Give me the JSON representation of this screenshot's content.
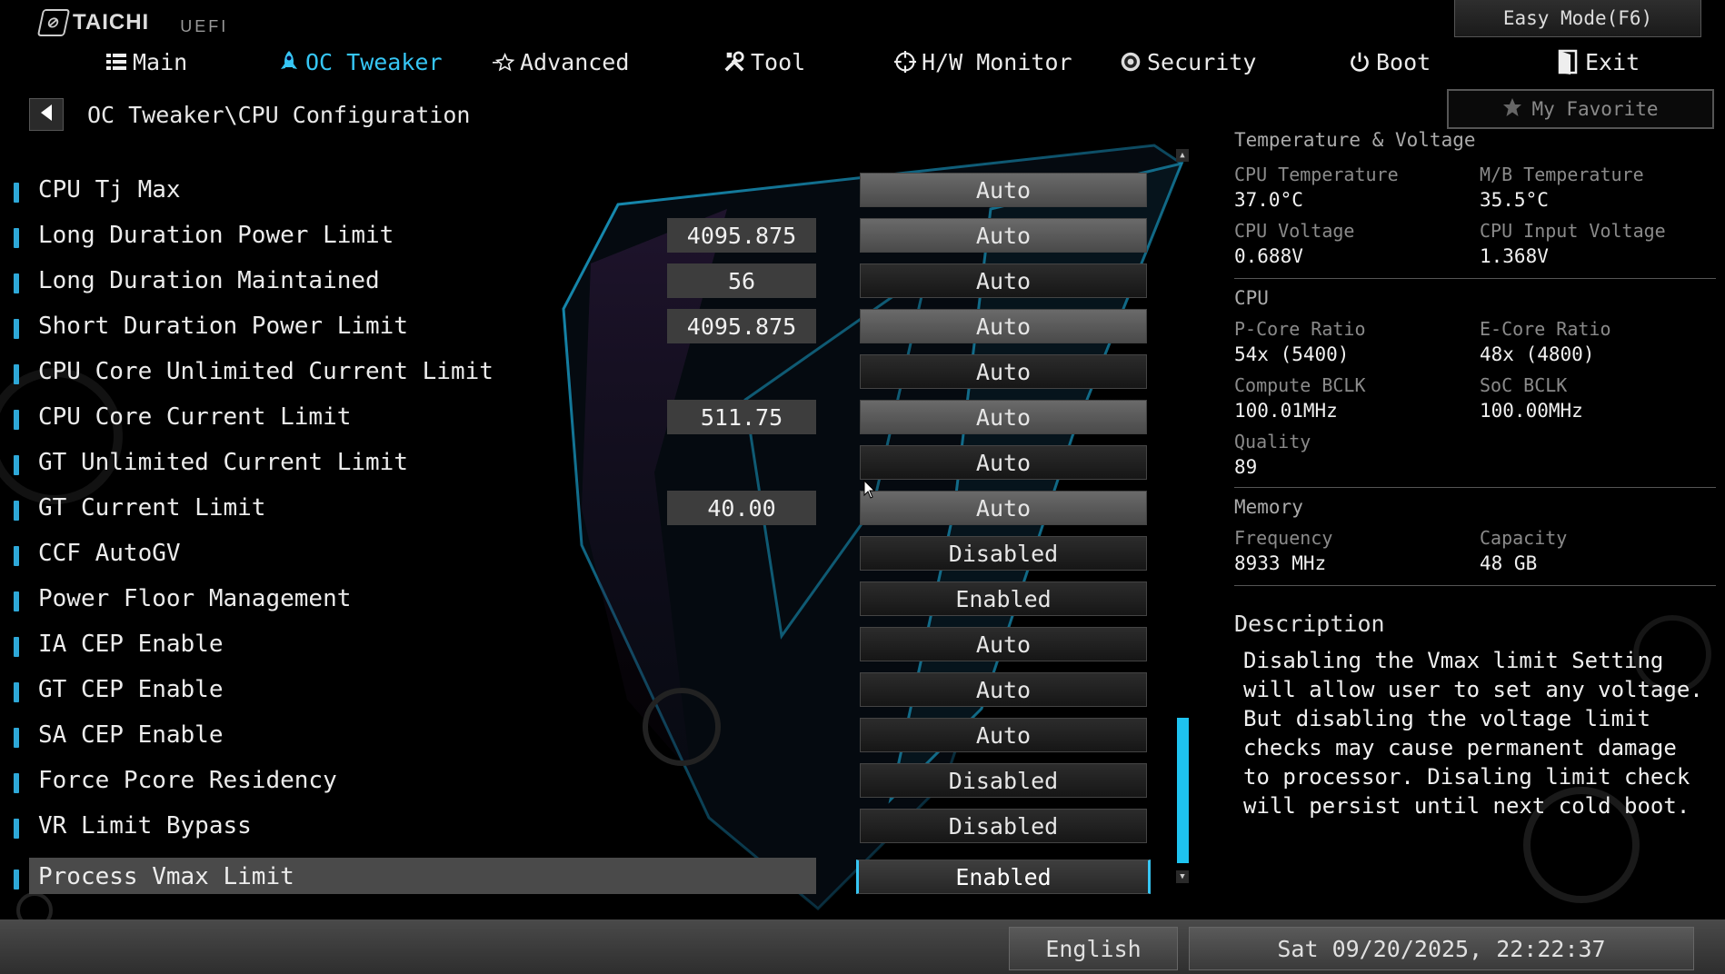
{
  "brand": {
    "name": "TAICHI",
    "sub": "UEFI"
  },
  "easy_mode_label": "Easy Mode(F6)",
  "nav": [
    {
      "label": "Main",
      "icon": "list-icon"
    },
    {
      "label": "OC Tweaker",
      "icon": "rocket-icon",
      "active": true
    },
    {
      "label": "Advanced",
      "icon": "star-outline-icon"
    },
    {
      "label": "Tool",
      "icon": "tools-icon"
    },
    {
      "label": "H/W Monitor",
      "icon": "crosshair-icon"
    },
    {
      "label": "Security",
      "icon": "shield-gear-icon"
    },
    {
      "label": "Boot",
      "icon": "power-icon"
    },
    {
      "label": "Exit",
      "icon": "exit-door-icon"
    }
  ],
  "breadcrumb": "OC Tweaker\\CPU Configuration",
  "favorite_label": "My Favorite",
  "settings": [
    {
      "label": "CPU Tj Max",
      "value": "",
      "option": "Auto",
      "style": "light"
    },
    {
      "label": "Long Duration Power Limit",
      "value": "4095.875",
      "option": "Auto",
      "style": "light"
    },
    {
      "label": "Long Duration Maintained",
      "value": "56",
      "option": "Auto",
      "style": "dark"
    },
    {
      "label": "Short Duration Power Limit",
      "value": "4095.875",
      "option": "Auto",
      "style": "light"
    },
    {
      "label": "CPU Core Unlimited Current Limit",
      "value": "",
      "option": "Auto",
      "style": "dark"
    },
    {
      "label": "CPU Core Current Limit",
      "value": "511.75",
      "option": "Auto",
      "style": "light"
    },
    {
      "label": "GT Unlimited Current Limit",
      "value": "",
      "option": "Auto",
      "style": "dark"
    },
    {
      "label": "GT Current Limit",
      "value": "40.00",
      "option": "Auto",
      "style": "light"
    },
    {
      "label": "CCF AutoGV",
      "value": "",
      "option": "Disabled",
      "style": "dark"
    },
    {
      "label": "Power Floor Management",
      "value": "",
      "option": "Enabled",
      "style": "dark"
    },
    {
      "label": "IA CEP Enable",
      "value": "",
      "option": "Auto",
      "style": "dark"
    },
    {
      "label": "GT CEP Enable",
      "value": "",
      "option": "Auto",
      "style": "dark"
    },
    {
      "label": "SA CEP Enable",
      "value": "",
      "option": "Auto",
      "style": "dark"
    },
    {
      "label": "Force Pcore Residency",
      "value": "",
      "option": "Disabled",
      "style": "dark"
    },
    {
      "label": "VR Limit Bypass",
      "value": "",
      "option": "Disabled",
      "style": "dark"
    },
    {
      "label": "Process Vmax Limit",
      "value": "",
      "option": "Enabled",
      "style": "focused",
      "selected": true
    }
  ],
  "hw_monitor": {
    "temp_title": "Temperature & Voltage",
    "cpu_temp_label": "CPU Temperature",
    "cpu_temp": "37.0°C",
    "mb_temp_label": "M/B Temperature",
    "mb_temp": "35.5°C",
    "cpu_volt_label": "CPU Voltage",
    "cpu_volt": "0.688V",
    "cpu_in_volt_label": "CPU Input Voltage",
    "cpu_in_volt": "1.368V",
    "cpu_title": "CPU",
    "pcore_label": "P-Core Ratio",
    "pcore": "54x (5400)",
    "ecore_label": "E-Core Ratio",
    "ecore": "48x (4800)",
    "bclk_label": "Compute BCLK",
    "bclk": "100.01MHz",
    "soc_label": "SoC BCLK",
    "soc": "100.00MHz",
    "quality_label": "Quality",
    "quality": "89",
    "mem_title": "Memory",
    "freq_label": "Frequency",
    "freq": "8933 MHz",
    "cap_label": "Capacity",
    "cap": "48 GB"
  },
  "description": {
    "title": "Description",
    "body": "Disabling the Vmax limit Setting will allow user to set any voltage. But disabling the voltage limit checks may cause permanent damage to processor. Disaling limit check will persist until next cold boot."
  },
  "footer": {
    "language": "English",
    "datetime": "Sat 09/20/2025, 22:22:37"
  },
  "colors": {
    "accent": "#36c6f4",
    "marker": "#2ea8d8",
    "scroll_thumb": "#1ec3f0"
  }
}
